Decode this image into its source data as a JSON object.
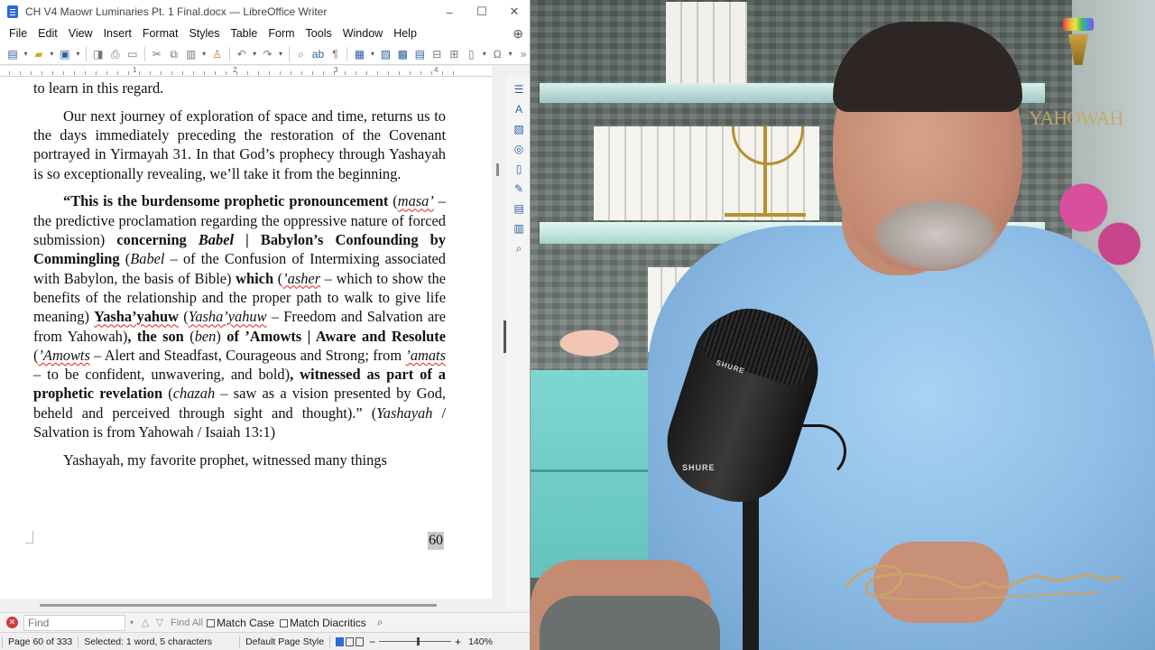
{
  "window": {
    "title": "CH V4 Maowr Luminaries Pt. 1 Final.docx — LibreOffice Writer",
    "controls": [
      "–",
      "☐",
      "✕"
    ]
  },
  "menu": [
    "File",
    "Edit",
    "View",
    "Insert",
    "Format",
    "Styles",
    "Table",
    "Form",
    "Tools",
    "Window",
    "Help"
  ],
  "ruler": {
    "numbers": [
      "1",
      "2",
      "3",
      "4"
    ]
  },
  "document": {
    "p1": "to learn in this regard.",
    "p2": "Our next journey of exploration of space and time, returns us to the days immediately preceding the restoration of the Covenant portrayed in Yirmayah 31. In that God’s prophecy through Yashayah is so exceptionally revealing, we’ll take it from the beginning.",
    "q": {
      "t1": "“This is the burdensome prophetic pronouncement",
      "t2": "(",
      "t3": "masa’",
      "t4": " – the predictive proclamation regarding the oppressive nature of forced submission) ",
      "t5": "concerning ",
      "t6": "Babel",
      "t7": " | Babylon’s Confounding by Commingling",
      "t8": " (",
      "t9": "Babel",
      "t10": " – of the Confusion of Intermixing associated with Babylon, the basis of Bible) ",
      "t11": "which",
      "t12": " (",
      "t13": "’asher",
      "t14": " – which to show the benefits of the relationship and the proper path to walk to give life meaning) ",
      "t15": "Yasha’yahuw",
      "t16": " (",
      "t17": "Yasha’yahuw",
      "t18": " – Freedom and Salvation are from Yahowah)",
      "t19": ", the son",
      "t20": " (",
      "t21": "ben",
      "t22": ") ",
      "t23": "of ’Amowts | Aware and Resolute",
      "t24": " (",
      "t25": "’Amowts",
      "t26": " – Alert and Steadfast, Courageous and Strong; from ",
      "t27": "’amats",
      "t28": " – to be confident, unwavering, and bold)",
      "t29": ", witnessed as part of a prophetic revelation",
      "t30": " (",
      "t31": "chazah",
      "t32": " – saw as a vision presented by God, beheld and perceived through sight and thought).”",
      "t33": " (",
      "t34": "Yashayah",
      "t35": " / Salvation is from Yahowah / Isaiah 13:1)"
    },
    "p4": "Yashayah, my favorite prophet, witnessed many things",
    "page_number": "60"
  },
  "findbar": {
    "placeholder": "Find",
    "find_all": "Find All",
    "match_case": "Match Case",
    "match_diacritics": "Match Diacritics"
  },
  "status": {
    "page": "Page 60 of 333",
    "selected": "Selected: 1 word, 5 characters",
    "style": "Default Page Style",
    "zoom": "140%"
  },
  "video": {
    "logo_text": "YAHOWAH",
    "mic_brand": "SHURE"
  },
  "colors": {
    "accent": "#2a6bd6",
    "spell_error": "#e02020",
    "shirt": "#8dbde6"
  }
}
